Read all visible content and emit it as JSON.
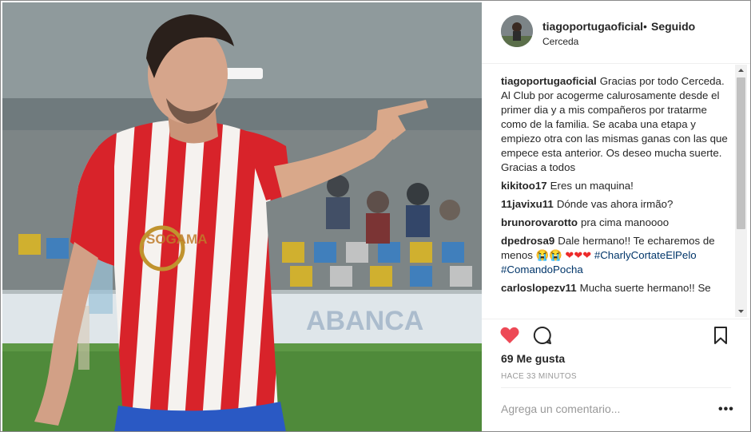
{
  "post": {
    "username": "tiagoportugaoficial",
    "separator": "•",
    "follow_status": "Seguido",
    "location": "Cerceda"
  },
  "comments": [
    {
      "user": "tiagoportugaoficial",
      "text": "Gracias por todo Cerceda. Al Club por acogerme calurosamente desde el primer dia y a mis compañeros por tratarme como de la familia. Se acaba una etapa y empiezo otra con las mismas ganas con las que empece esta anterior. Os deseo mucha suerte. Gracias a todos"
    },
    {
      "user": "kikitoo17",
      "text": "Eres un maquina!"
    },
    {
      "user": "11javixu11",
      "text": "Dónde vas ahora irmão?"
    },
    {
      "user": "brunorovarotto",
      "text": "pra cima manoooo"
    },
    {
      "user": "dpedrosa9",
      "text": "Dale hermano!! Te echaremos de menos 😭😭",
      "hearts": "❤❤❤",
      "tags": [
        "#CharlyCortateElPelo",
        "#ComandoPocha"
      ]
    },
    {
      "user": "carloslopezv11",
      "text": "Mucha suerte hermano!! Se"
    }
  ],
  "likes_text": "69 Me gusta",
  "time_ago": "HACE 33 MINUTOS",
  "comment_placeholder": "Agrega un comentario...",
  "more_label": "•••",
  "icons": {
    "like": "heart-icon",
    "comment": "comment-icon",
    "save": "bookmark-icon",
    "scroll_up": "scroll-up-arrow-icon",
    "scroll_down": "scroll-down-arrow-icon"
  },
  "colors": {
    "like_active": "#ed4956",
    "hashtag": "#003569",
    "kit_red": "#d8232a"
  }
}
